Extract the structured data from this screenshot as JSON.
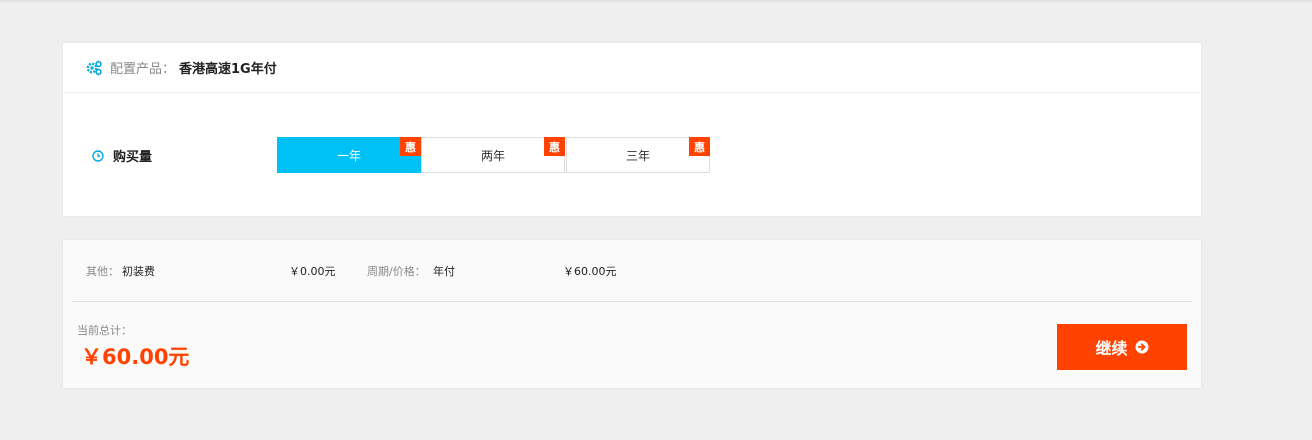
{
  "config": {
    "label": "配置产品：",
    "product": "香港高速1G年付",
    "icon": "gears-icon"
  },
  "purchase": {
    "label": "购买量",
    "icon": "clock-icon",
    "options": [
      {
        "label": "一年",
        "badge": "惠",
        "selected": true
      },
      {
        "label": "两年",
        "badge": "惠",
        "selected": false
      },
      {
        "label": "三年",
        "badge": "惠",
        "selected": false
      }
    ]
  },
  "summary": {
    "other_label": "其他：",
    "other_item": "初装费",
    "other_price": "￥0.00元",
    "cycle_label": "周期/价格：",
    "cycle_value": "年付",
    "cycle_price": "￥60.00元",
    "total_label": "当前总计：",
    "total_value": "￥60.00元",
    "continue_label": "继续"
  },
  "colors": {
    "accent": "#00c1f6",
    "highlight": "#ff4200",
    "background": "#efefef"
  }
}
